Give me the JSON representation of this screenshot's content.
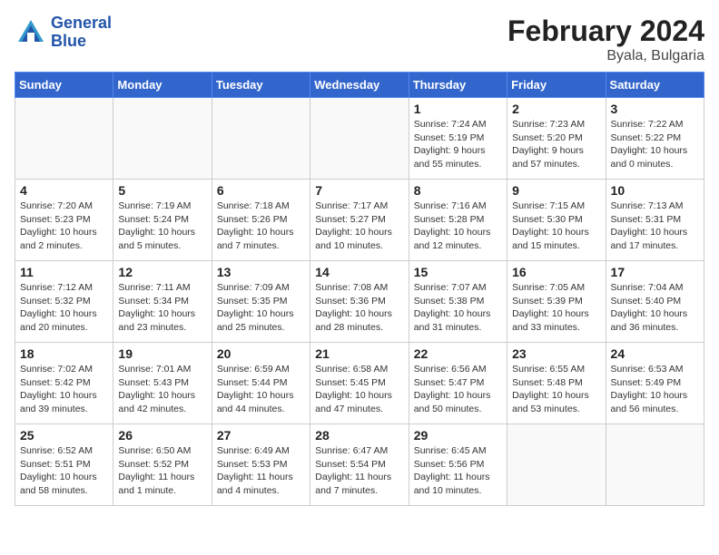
{
  "header": {
    "logo_line1": "General",
    "logo_line2": "Blue",
    "title": "February 2024",
    "subtitle": "Byala, Bulgaria"
  },
  "weekdays": [
    "Sunday",
    "Monday",
    "Tuesday",
    "Wednesday",
    "Thursday",
    "Friday",
    "Saturday"
  ],
  "weeks": [
    [
      {
        "day": null,
        "info": null
      },
      {
        "day": null,
        "info": null
      },
      {
        "day": null,
        "info": null
      },
      {
        "day": null,
        "info": null
      },
      {
        "day": "1",
        "info": "Sunrise: 7:24 AM\nSunset: 5:19 PM\nDaylight: 9 hours\nand 55 minutes."
      },
      {
        "day": "2",
        "info": "Sunrise: 7:23 AM\nSunset: 5:20 PM\nDaylight: 9 hours\nand 57 minutes."
      },
      {
        "day": "3",
        "info": "Sunrise: 7:22 AM\nSunset: 5:22 PM\nDaylight: 10 hours\nand 0 minutes."
      }
    ],
    [
      {
        "day": "4",
        "info": "Sunrise: 7:20 AM\nSunset: 5:23 PM\nDaylight: 10 hours\nand 2 minutes."
      },
      {
        "day": "5",
        "info": "Sunrise: 7:19 AM\nSunset: 5:24 PM\nDaylight: 10 hours\nand 5 minutes."
      },
      {
        "day": "6",
        "info": "Sunrise: 7:18 AM\nSunset: 5:26 PM\nDaylight: 10 hours\nand 7 minutes."
      },
      {
        "day": "7",
        "info": "Sunrise: 7:17 AM\nSunset: 5:27 PM\nDaylight: 10 hours\nand 10 minutes."
      },
      {
        "day": "8",
        "info": "Sunrise: 7:16 AM\nSunset: 5:28 PM\nDaylight: 10 hours\nand 12 minutes."
      },
      {
        "day": "9",
        "info": "Sunrise: 7:15 AM\nSunset: 5:30 PM\nDaylight: 10 hours\nand 15 minutes."
      },
      {
        "day": "10",
        "info": "Sunrise: 7:13 AM\nSunset: 5:31 PM\nDaylight: 10 hours\nand 17 minutes."
      }
    ],
    [
      {
        "day": "11",
        "info": "Sunrise: 7:12 AM\nSunset: 5:32 PM\nDaylight: 10 hours\nand 20 minutes."
      },
      {
        "day": "12",
        "info": "Sunrise: 7:11 AM\nSunset: 5:34 PM\nDaylight: 10 hours\nand 23 minutes."
      },
      {
        "day": "13",
        "info": "Sunrise: 7:09 AM\nSunset: 5:35 PM\nDaylight: 10 hours\nand 25 minutes."
      },
      {
        "day": "14",
        "info": "Sunrise: 7:08 AM\nSunset: 5:36 PM\nDaylight: 10 hours\nand 28 minutes."
      },
      {
        "day": "15",
        "info": "Sunrise: 7:07 AM\nSunset: 5:38 PM\nDaylight: 10 hours\nand 31 minutes."
      },
      {
        "day": "16",
        "info": "Sunrise: 7:05 AM\nSunset: 5:39 PM\nDaylight: 10 hours\nand 33 minutes."
      },
      {
        "day": "17",
        "info": "Sunrise: 7:04 AM\nSunset: 5:40 PM\nDaylight: 10 hours\nand 36 minutes."
      }
    ],
    [
      {
        "day": "18",
        "info": "Sunrise: 7:02 AM\nSunset: 5:42 PM\nDaylight: 10 hours\nand 39 minutes."
      },
      {
        "day": "19",
        "info": "Sunrise: 7:01 AM\nSunset: 5:43 PM\nDaylight: 10 hours\nand 42 minutes."
      },
      {
        "day": "20",
        "info": "Sunrise: 6:59 AM\nSunset: 5:44 PM\nDaylight: 10 hours\nand 44 minutes."
      },
      {
        "day": "21",
        "info": "Sunrise: 6:58 AM\nSunset: 5:45 PM\nDaylight: 10 hours\nand 47 minutes."
      },
      {
        "day": "22",
        "info": "Sunrise: 6:56 AM\nSunset: 5:47 PM\nDaylight: 10 hours\nand 50 minutes."
      },
      {
        "day": "23",
        "info": "Sunrise: 6:55 AM\nSunset: 5:48 PM\nDaylight: 10 hours\nand 53 minutes."
      },
      {
        "day": "24",
        "info": "Sunrise: 6:53 AM\nSunset: 5:49 PM\nDaylight: 10 hours\nand 56 minutes."
      }
    ],
    [
      {
        "day": "25",
        "info": "Sunrise: 6:52 AM\nSunset: 5:51 PM\nDaylight: 10 hours\nand 58 minutes."
      },
      {
        "day": "26",
        "info": "Sunrise: 6:50 AM\nSunset: 5:52 PM\nDaylight: 11 hours\nand 1 minute."
      },
      {
        "day": "27",
        "info": "Sunrise: 6:49 AM\nSunset: 5:53 PM\nDaylight: 11 hours\nand 4 minutes."
      },
      {
        "day": "28",
        "info": "Sunrise: 6:47 AM\nSunset: 5:54 PM\nDaylight: 11 hours\nand 7 minutes."
      },
      {
        "day": "29",
        "info": "Sunrise: 6:45 AM\nSunset: 5:56 PM\nDaylight: 11 hours\nand 10 minutes."
      },
      {
        "day": null,
        "info": null
      },
      {
        "day": null,
        "info": null
      }
    ]
  ]
}
